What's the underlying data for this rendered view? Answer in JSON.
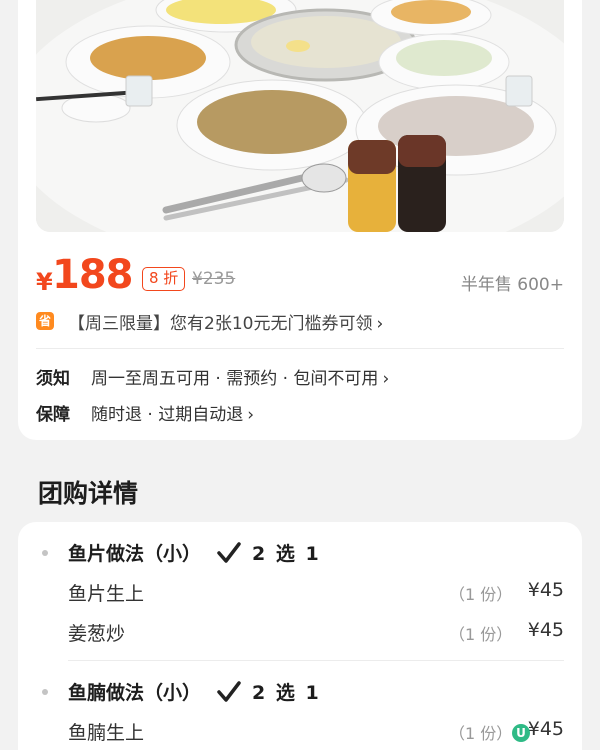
{
  "product": {
    "photo_icon": "food-table-photo",
    "currency": "¥",
    "price": "188",
    "discount": "8 折",
    "original_price": "¥235",
    "sold": "半年售 600+",
    "coupon_badge": "省",
    "coupon_text": "【周三限量】您有2张10元无门槛券可领",
    "notice_label": "须知",
    "notice_value": "周一至周五可用 · 需预约 · 包间不可用",
    "guarantee_label": "保障",
    "guarantee_value": "随时退 · 过期自动退",
    "accent_color": "#f2471d"
  },
  "section": {
    "title": "团购详情"
  },
  "groups": [
    {
      "name": "鱼片做法（小）",
      "choose": "2 选 1",
      "items": [
        {
          "name": "鱼片生上",
          "qty": "（1 份）",
          "price": "¥45"
        },
        {
          "name": "姜葱炒",
          "qty": "（1 份）",
          "price": "¥45"
        }
      ]
    },
    {
      "name": "鱼腩做法（小）",
      "choose": "2 选 1",
      "items": [
        {
          "name": "鱼腩生上",
          "qty": "（1 份）",
          "price": "¥45"
        }
      ]
    }
  ]
}
